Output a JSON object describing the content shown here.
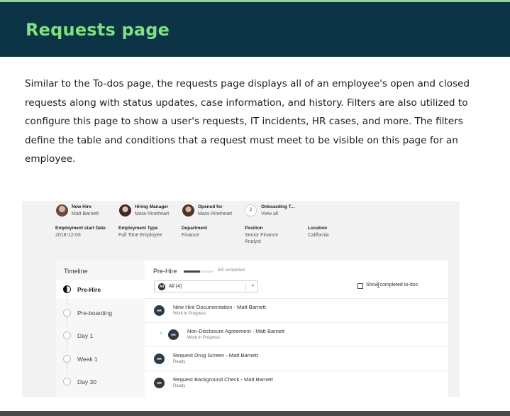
{
  "header": {
    "title": "Requests page"
  },
  "body_text": "Similar to the To-dos page, the requests page displays all of an employee's open and closed requests along with status updates, case information, and history. Filters are also utilized to configure this page to show a user's requests, IT incidents, HR cases, and more. The filters define the table and conditions that a request must meet to be visible on this page for an employee.",
  "screenshot": {
    "people": [
      {
        "label": "New Hire",
        "name": "Matt Barnett"
      },
      {
        "label": "Hiring Manager",
        "name": "Mara Rineheart"
      },
      {
        "label": "Opened for",
        "name": "Mara Rineheart"
      },
      {
        "label": "Onboarding T...",
        "name": "View all",
        "badge": "2"
      }
    ],
    "details": [
      {
        "label": "Employment start Date",
        "value": "2018-12-03"
      },
      {
        "label": "Employment Type",
        "value": "Full Time Employee"
      },
      {
        "label": "Department",
        "value": "Finance"
      },
      {
        "label": "Position",
        "value": "Senior Finance",
        "value2": "Analyst"
      },
      {
        "label": "Location",
        "value": "California"
      }
    ],
    "timeline": {
      "title": "Timeline",
      "items": [
        {
          "label": "Pre-Hire",
          "active": true
        },
        {
          "label": "Pre-boarding"
        },
        {
          "label": "Day 1"
        },
        {
          "label": "Week 1"
        },
        {
          "label": "Day 30"
        }
      ]
    },
    "phase": {
      "title": "Pre-Hire",
      "progress": 0.5556,
      "count": "5/9 completed"
    },
    "filter": {
      "badge": "All",
      "selected": "All (4)",
      "caret": "▾"
    },
    "show_completed": "Show completed to-dos",
    "tasks": [
      {
        "badge": "HR",
        "title": "New Hire Documentation - Matt Barnett",
        "status": "Work in Progress",
        "indent": false
      },
      {
        "badge": "HR",
        "title": "Non-Disclosure Agreement - Matt Barnett",
        "status": "Work in Progress",
        "indent": true,
        "arrow": "↳"
      },
      {
        "badge": "HR",
        "title": "Request Drug Screen - Matt Barnett",
        "status": "Ready",
        "indent": false
      },
      {
        "badge": "HR",
        "title": "Request Background Check - Matt Barnett",
        "status": "Ready",
        "indent": false
      }
    ]
  }
}
